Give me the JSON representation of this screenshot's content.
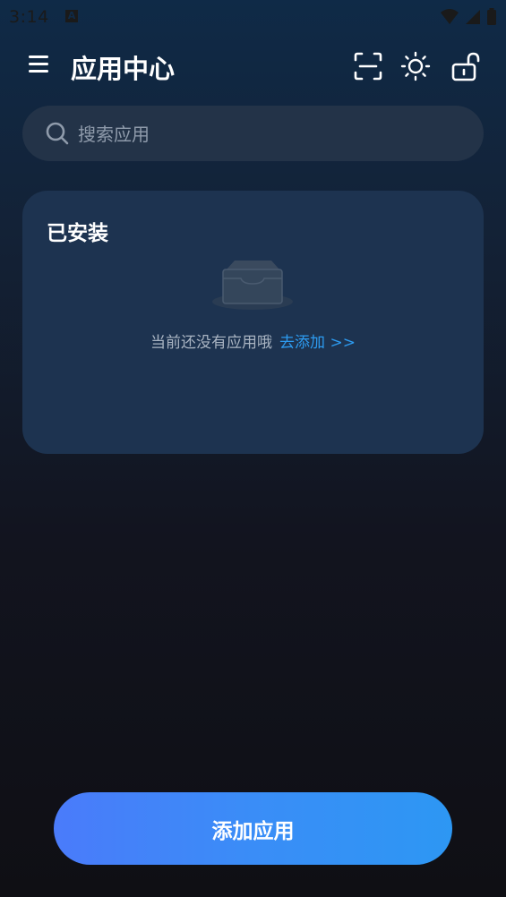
{
  "status_bar": {
    "time": "3:14",
    "notification_letter": "A"
  },
  "header": {
    "title": "应用中心",
    "icons": [
      "menu-icon",
      "scan-icon",
      "brightness-icon",
      "unlock-icon"
    ]
  },
  "search": {
    "placeholder": "搜索应用",
    "value": ""
  },
  "installed": {
    "title": "已安装",
    "empty_text": "当前还没有应用哦",
    "add_link": "去添加 >>"
  },
  "footer": {
    "add_button_label": "添加应用"
  },
  "colors": {
    "accent": "#2d9bf0",
    "card_bg": "#1d3350",
    "search_bg": "#233348",
    "button_start": "#4a7bfa",
    "button_end": "#2d97f3"
  }
}
